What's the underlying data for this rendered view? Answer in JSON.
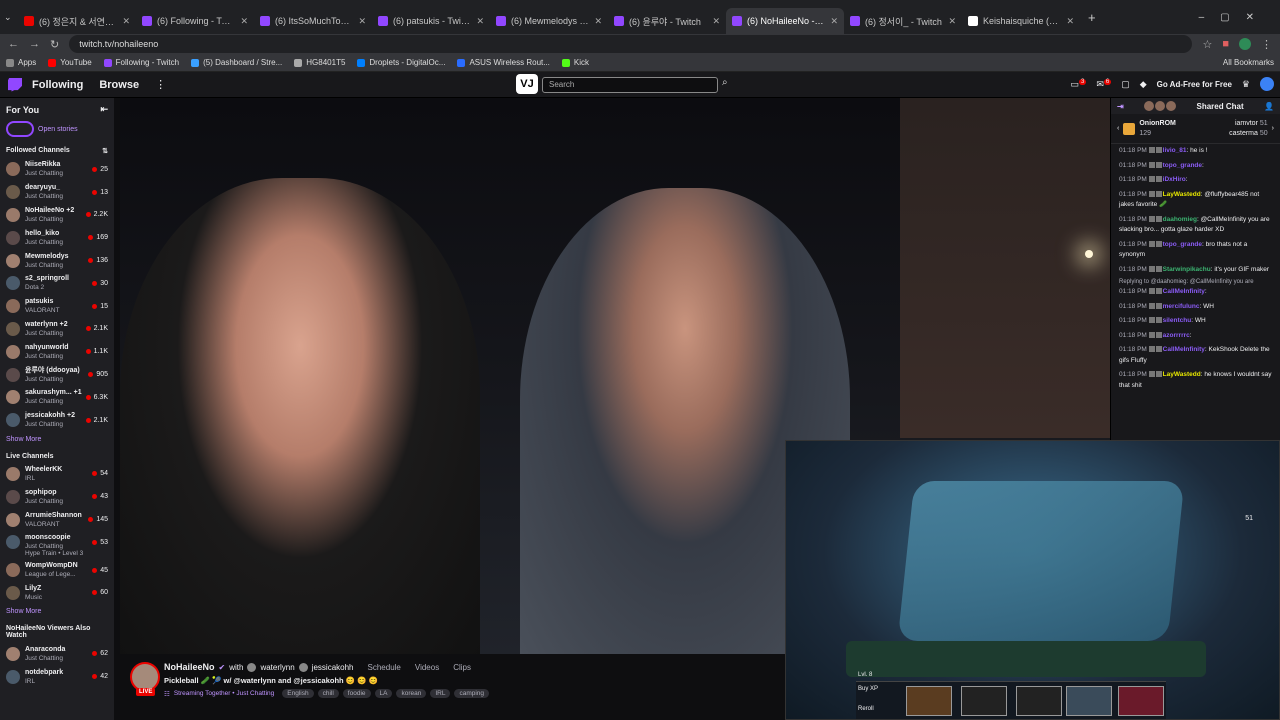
{
  "browser": {
    "tabs": [
      {
        "title": "(6) 정은지 & 서연국 - All For Y",
        "color": "#eb0400",
        "active": false
      },
      {
        "title": "(6) Following - Twitch",
        "color": "#9147ff",
        "active": false
      },
      {
        "title": "(6) ItsSoMuchToast - Twitch",
        "color": "#9147ff",
        "active": false
      },
      {
        "title": "(6) patsukis - Twitch",
        "color": "#9147ff",
        "active": false
      },
      {
        "title": "(6) Mewmelodys - Twitch",
        "color": "#9147ff",
        "active": false
      },
      {
        "title": "(6) 윤루야 - Twitch",
        "color": "#9147ff",
        "active": false
      },
      {
        "title": "(6) NoHaileeNo - Twitch",
        "color": "#9147ff",
        "active": true
      },
      {
        "title": "(6) 정서이_ - Twitch",
        "color": "#9147ff",
        "active": false
      },
      {
        "title": "Keishaisquiche (@keishaisquic",
        "color": "#ffffff",
        "active": false
      }
    ],
    "url": "twitch.tv/nohaileeno",
    "bookmarks": [
      "Apps",
      "YouTube",
      "Following - Twitch",
      "(5) Dashboard / Stre...",
      "HG8401T5",
      "Droplets - DigitalOc...",
      "ASUS Wireless Rout...",
      "Kick"
    ],
    "all_bookmarks": "All Bookmarks"
  },
  "nav": {
    "following": "Following",
    "browse": "Browse",
    "more": "⋮",
    "logo_text": "VJ",
    "search_placeholder": "Search",
    "ad_free": "Go Ad-Free for Free",
    "notif_count_1": "3",
    "notif_count_2": "6"
  },
  "sidebar": {
    "for_you": "For You",
    "open_stories": "Open stories",
    "followed_header": "Followed Channels",
    "followed": [
      {
        "name": "NiiseRikka",
        "game": "Just Chatting",
        "viewers": "25"
      },
      {
        "name": "dearyuyu_",
        "game": "Just Chatting",
        "viewers": "13"
      },
      {
        "name": "NoHaileeNo +2",
        "game": "Just Chatting",
        "viewers": "2.2K"
      },
      {
        "name": "hello_kiko",
        "game": "Just Chatting",
        "viewers": "169"
      },
      {
        "name": "Mewmelodys",
        "game": "Just Chatting",
        "viewers": "136"
      },
      {
        "name": "s2_springroll",
        "game": "Dota 2",
        "viewers": "30"
      },
      {
        "name": "patsukis",
        "game": "VALORANT",
        "viewers": "15"
      },
      {
        "name": "waterlynn +2",
        "game": "Just Chatting",
        "viewers": "2.1K"
      },
      {
        "name": "nahyunworld",
        "game": "Just Chatting",
        "viewers": "1.1K"
      },
      {
        "name": "윤루야 (ddooyaa)",
        "game": "Just Chatting",
        "viewers": "905"
      },
      {
        "name": "sakurashym... +1",
        "game": "Just Chatting",
        "viewers": "6.3K"
      },
      {
        "name": "jessicakohh +2",
        "game": "Just Chatting",
        "viewers": "2.1K"
      }
    ],
    "show_more": "Show More",
    "live_header": "Live Channels",
    "live": [
      {
        "name": "WheelerKK",
        "game": "IRL",
        "viewers": "54"
      },
      {
        "name": "sophipop",
        "game": "Just Chatting",
        "viewers": "43"
      },
      {
        "name": "ArrumieShannon",
        "game": "VALORANT",
        "viewers": "145"
      },
      {
        "name": "moonscoopie",
        "game": "Just Chatting",
        "viewers": "53"
      },
      {
        "name": "WompWompDN",
        "game": "League of Lege...",
        "viewers": "45"
      },
      {
        "name": "LilyZ",
        "game": "Music",
        "viewers": "60"
      }
    ],
    "hype_train": "Hype Train • Level 3",
    "show_more_2": "Show More",
    "also_watch_header": "NoHaileeNo Viewers Also Watch",
    "also_watch": [
      {
        "name": "Anaraconda",
        "game": "Just Chatting",
        "viewers": "62"
      },
      {
        "name": "notdebpark",
        "game": "IRL",
        "viewers": "42"
      }
    ]
  },
  "stream": {
    "streamer": "NoHaileeNo",
    "with": "with",
    "collab1": "waterlynn",
    "collab2": "jessicakohh",
    "tab_schedule": "Schedule",
    "tab_videos": "Videos",
    "tab_clips": "Clips",
    "title": "Pickleball 🥒 🎾 w/ @waterlynn and @jessicakohh 😊 😊 😊",
    "status": "Streaming Together • Just Chatting",
    "tags": [
      "English",
      "chill",
      "foodie",
      "LA",
      "korean",
      "IRL",
      "camping"
    ],
    "live_label": "LIVE"
  },
  "chat": {
    "header": "Shared Chat",
    "leaderboard": {
      "top_name": "OnionROM",
      "top_count": "129",
      "r1_name": "iamvtor",
      "r1_count": "51",
      "r2_name": "casterma",
      "r2_count": "50"
    },
    "messages": [
      {
        "time": "01:18 PM",
        "user": "livio_81",
        "color": "#8b5cf6",
        "text": "he is !"
      },
      {
        "time": "01:18 PM",
        "user": "topo_grande",
        "color": "#8b5cf6",
        "text": ""
      },
      {
        "time": "01:18 PM",
        "user": "iDxHiro",
        "color": "#8b5cf6",
        "text": ""
      },
      {
        "time": "01:18 PM",
        "user": "LayWastedd",
        "color": "#e6e600",
        "text": "@fluffybear485 not jakes favorite 🥒"
      },
      {
        "time": "01:18 PM",
        "user": "daahomieg",
        "color": "#3cb371",
        "text": "@CallMeInfinity you are slacking bro... gotta glaze harder XD"
      },
      {
        "time": "01:18 PM",
        "user": "topo_grande",
        "color": "#8b5cf6",
        "text": "bro thats not a synonym"
      },
      {
        "time": "01:18 PM",
        "user": "Starwinpikachu",
        "color": "#3cb371",
        "text": "it's your GIF maker"
      },
      {
        "time": "01:18 PM",
        "user": "CallMeInfinity",
        "color": "#8b5cf6",
        "text": "",
        "reply": "Replying to @daahomieg: @CallMeInfinity you are"
      },
      {
        "time": "01:18 PM",
        "user": "mercifulunc",
        "color": "#8b5cf6",
        "text": "WH"
      },
      {
        "time": "01:18 PM",
        "user": "silentchu",
        "color": "#8b5cf6",
        "text": "WH"
      },
      {
        "time": "01:18 PM",
        "user": "azorrrrrc",
        "color": "#8b5cf6",
        "text": ""
      },
      {
        "time": "01:18 PM",
        "user": "CallMeInfinity",
        "color": "#8b5cf6",
        "text": "KekShook Delete the gifs Fluffy"
      },
      {
        "time": "01:18 PM",
        "user": "LayWastedd",
        "color": "#e6e600",
        "text": "he knows I wouldnt say that shit"
      }
    ]
  },
  "game_overlay": {
    "lvl": "Lvl. 8",
    "buy_xp": "Buy XP",
    "reroll": "Reroll",
    "gold": "51"
  }
}
